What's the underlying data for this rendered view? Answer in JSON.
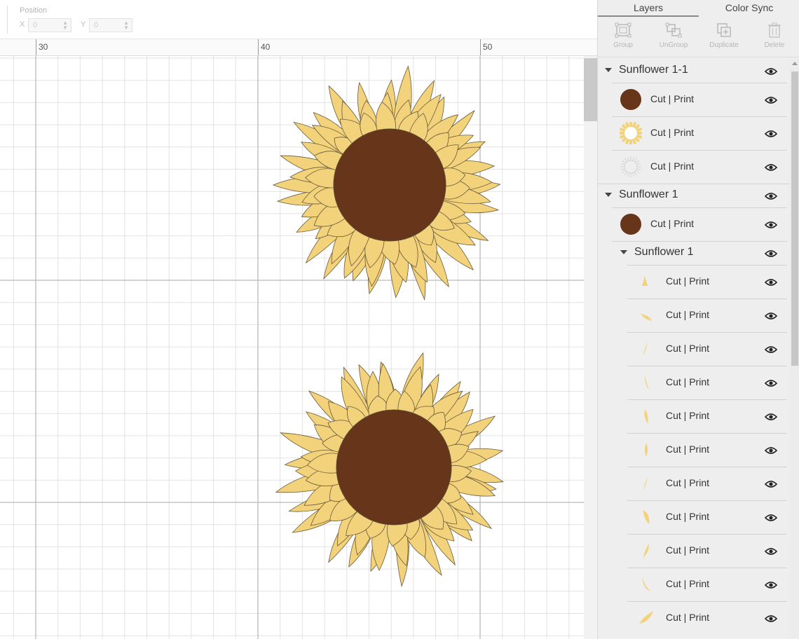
{
  "position_bar": {
    "label": "Position",
    "x_label": "X",
    "x_value": "0",
    "y_label": "Y",
    "y_value": "0"
  },
  "ruler": {
    "labels": [
      "30",
      "40",
      "50"
    ]
  },
  "canvas": {
    "objects": [
      {
        "name": "Sunflower 1-1",
        "petal_color": "#f2d27b",
        "center_color": "#67351a"
      },
      {
        "name": "Sunflower 1",
        "petal_color": "#f2d27b",
        "center_color": "#67351a"
      }
    ]
  },
  "panel": {
    "tabs": [
      "Layers",
      "Color Sync"
    ],
    "active_tab": "Layers",
    "toolbar": [
      {
        "label": "Group",
        "icon": "group-icon",
        "enabled": false
      },
      {
        "label": "UnGroup",
        "icon": "ungroup-icon",
        "enabled": false
      },
      {
        "label": "Duplicate",
        "icon": "duplicate-icon",
        "enabled": false
      },
      {
        "label": "Delete",
        "icon": "trash-icon",
        "enabled": false
      }
    ],
    "layer_groups": [
      {
        "name": "Sunflower 1-1",
        "expanded": true,
        "layers": [
          {
            "label": "Cut | Print",
            "thumb": "brown-circle"
          },
          {
            "label": "Cut | Print",
            "thumb": "yellow-ring"
          },
          {
            "label": "Cut | Print",
            "thumb": "outline-ring"
          }
        ]
      },
      {
        "name": "Sunflower 1",
        "expanded": true,
        "layers": [
          {
            "label": "Cut | Print",
            "thumb": "brown-circle"
          }
        ],
        "subgroup": {
          "name": "Sunflower 1",
          "expanded": true,
          "layers": [
            {
              "label": "Cut | Print",
              "thumb": "petal"
            },
            {
              "label": "Cut | Print",
              "thumb": "petal"
            },
            {
              "label": "Cut | Print",
              "thumb": "petal"
            },
            {
              "label": "Cut | Print",
              "thumb": "petal"
            },
            {
              "label": "Cut | Print",
              "thumb": "petal"
            },
            {
              "label": "Cut | Print",
              "thumb": "petal"
            },
            {
              "label": "Cut | Print",
              "thumb": "petal"
            },
            {
              "label": "Cut | Print",
              "thumb": "petal"
            },
            {
              "label": "Cut | Print",
              "thumb": "petal"
            },
            {
              "label": "Cut | Print",
              "thumb": "petal"
            },
            {
              "label": "Cut | Print",
              "thumb": "petal"
            }
          ]
        }
      }
    ],
    "colors": {
      "petal": "#f2d27b",
      "petal_outline": "#6b5a3a",
      "center": "#67351a",
      "eye": "#222222"
    }
  }
}
